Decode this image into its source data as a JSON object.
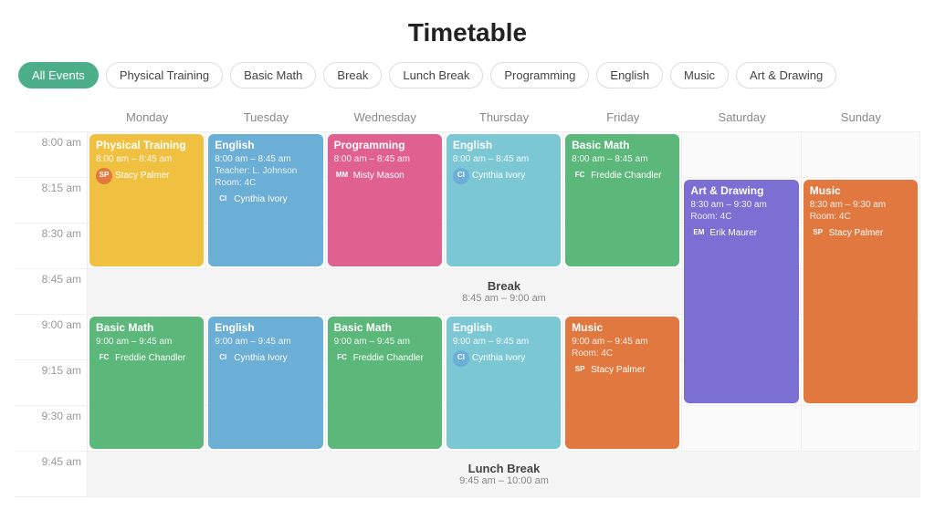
{
  "page": {
    "title": "Timetable"
  },
  "filters": {
    "items": [
      {
        "label": "All Events",
        "active": true
      },
      {
        "label": "Physical Training",
        "active": false
      },
      {
        "label": "Basic Math",
        "active": false
      },
      {
        "label": "Break",
        "active": false
      },
      {
        "label": "Lunch Break",
        "active": false
      },
      {
        "label": "Programming",
        "active": false
      },
      {
        "label": "English",
        "active": false
      },
      {
        "label": "Music",
        "active": false
      },
      {
        "label": "Art & Drawing",
        "active": false
      }
    ]
  },
  "days": [
    "Monday",
    "Tuesday",
    "Wednesday",
    "Thursday",
    "Friday",
    "Saturday",
    "Sunday"
  ],
  "times": [
    "8:00 am",
    "8:15 am",
    "8:30 am",
    "8:45 am",
    "9:00 am",
    "9:15 am",
    "9:30 am",
    "9:45 am"
  ],
  "break1": {
    "title": "Break",
    "time": "8:45 am – 9:00 am"
  },
  "lunch": {
    "title": "Lunch Break",
    "time": "9:45 am – 10:00 am"
  },
  "events": {
    "monday_physical": {
      "title": "Physical Training",
      "time": "8:00 am – 8:45 am",
      "person": "Stacy Palmer",
      "color": "yellow",
      "row_start": 1,
      "row_span": 3
    },
    "tuesday_english1": {
      "title": "English",
      "time": "8:00 am – 8:45 am",
      "teacher": "Teacher: L. Johnson",
      "room": "Room: 4C",
      "person": "Cynthia Ivory",
      "color": "blue",
      "row_start": 1,
      "row_span": 3
    },
    "wednesday_programming": {
      "title": "Programming",
      "time": "8:00 am – 8:45 am",
      "person": "Misty Mason",
      "color": "pink",
      "row_start": 1,
      "row_span": 3
    },
    "thursday_english1": {
      "title": "English",
      "time": "8:00 am – 8:45 am",
      "person": "Cynthia Ivory",
      "color": "lightblue",
      "row_start": 1,
      "row_span": 3
    },
    "friday_basicmath1": {
      "title": "Basic Math",
      "time": "8:00 am – 8:45 am",
      "person": "Freddie Chandler",
      "color": "green",
      "row_start": 1,
      "row_span": 3
    },
    "saturday_artdrawing": {
      "title": "Art & Drawing",
      "time": "8:30 am – 9:30 am",
      "room": "Room: 4C",
      "person": "Erik Maurer",
      "color": "purple",
      "row_start": 2,
      "row_span": 5
    },
    "sunday_music1": {
      "title": "Music",
      "time": "8:30 am – 9:30 am",
      "room": "Room: 4C",
      "person": "Stacy Palmer",
      "color": "orange",
      "row_start": 2,
      "row_span": 5
    },
    "monday_basicmath": {
      "title": "Basic Math",
      "time": "9:00 am – 9:45 am",
      "person": "Freddie Chandler",
      "color": "green",
      "row_start": 6,
      "row_span": 3
    },
    "tuesday_english2": {
      "title": "English",
      "time": "9:00 am – 9:45 am",
      "person": "Cynthia Ivory",
      "color": "blue",
      "row_start": 6,
      "row_span": 3
    },
    "wednesday_basicmath": {
      "title": "Basic Math",
      "time": "9:00 am – 9:45 am",
      "person": "Freddie Chandler",
      "color": "green",
      "row_start": 6,
      "row_span": 3
    },
    "thursday_english2": {
      "title": "English",
      "time": "9:00 am – 9:45 am",
      "person": "Cynthia Ivory",
      "color": "lightblue",
      "row_start": 6,
      "row_span": 3
    },
    "friday_music": {
      "title": "Music",
      "time": "9:00 am – 9:45 am",
      "room": "Room: 4C",
      "person": "Stacy Palmer",
      "color": "orange",
      "row_start": 6,
      "row_span": 3
    }
  },
  "avatars": {
    "Stacy Palmer": "#e07840",
    "Cynthia Ivory": "#6baed6",
    "Misty Mason": "#e06090",
    "Freddie Chandler": "#5cb87a",
    "Erik Maurer": "#7b6fd4"
  }
}
